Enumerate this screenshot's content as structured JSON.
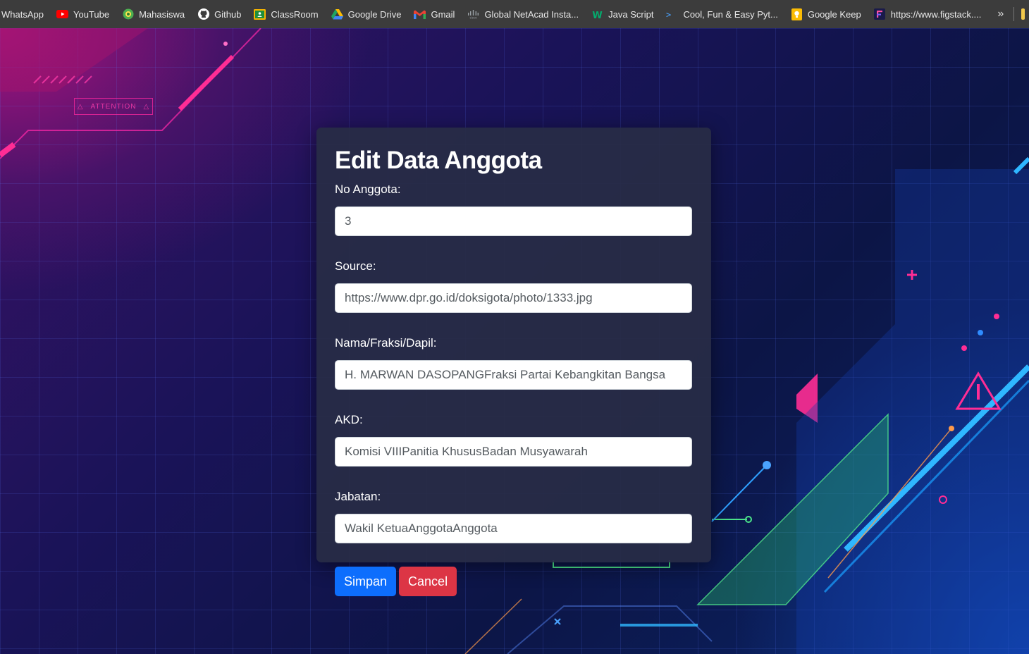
{
  "bookmarks": {
    "items": [
      {
        "label": "WhatsApp",
        "icon": "whatsapp-icon"
      },
      {
        "label": "YouTube",
        "icon": "youtube-icon"
      },
      {
        "label": "Mahasiswa",
        "icon": "mahasiswa-icon"
      },
      {
        "label": "Github",
        "icon": "github-icon"
      },
      {
        "label": "ClassRoom",
        "icon": "classroom-icon"
      },
      {
        "label": "Google Drive",
        "icon": "google-drive-icon"
      },
      {
        "label": "Gmail",
        "icon": "gmail-icon"
      },
      {
        "label": "Global NetAcad Insta...",
        "icon": "cisco-icon"
      },
      {
        "label": "Java Script",
        "icon": "w3schools-icon"
      },
      {
        "label": "Cool, Fun & Easy Pyt...",
        "icon": "terminal-icon"
      },
      {
        "label": "Google Keep",
        "icon": "google-keep-icon"
      },
      {
        "label": "https://www.figstack....",
        "icon": "figstack-icon"
      }
    ],
    "more_label": "»"
  },
  "background": {
    "attention_label": "ATTENTION"
  },
  "form": {
    "title": "Edit Data Anggota",
    "fields": [
      {
        "label": "No Anggota:",
        "value": "3"
      },
      {
        "label": "Source:",
        "value": "https://www.dpr.go.id/doksigota/photo/1333.jpg"
      },
      {
        "label": "Nama/Fraksi/Dapil:",
        "value": "H. MARWAN DASOPANGFraksi Partai Kebangkitan Bangsa"
      },
      {
        "label": "AKD:",
        "value": "Komisi VIIIPanitia KhususBadan Musyawarah"
      },
      {
        "label": "Jabatan:",
        "value": "Wakil KetuaAnggotaAnggota"
      }
    ],
    "save_label": "Simpan",
    "cancel_label": "Cancel"
  },
  "colors": {
    "primary": "#0d6efd",
    "danger": "#dc3545",
    "modal_bg": "#282c46",
    "bookmark_bar": "#3c3c3c"
  }
}
